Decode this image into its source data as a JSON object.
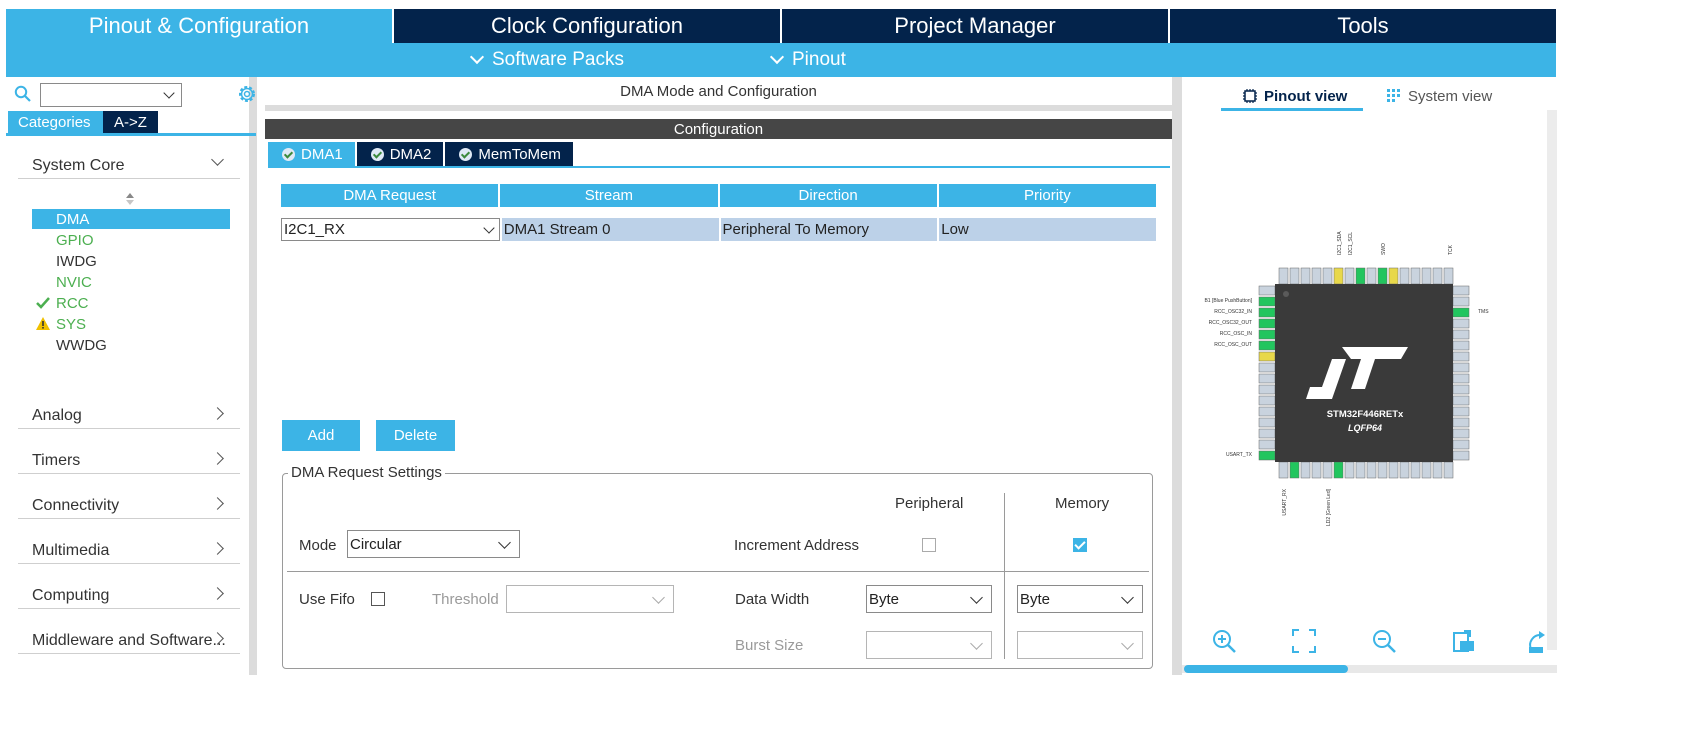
{
  "top_tabs": [
    {
      "label": "Pinout & Configuration"
    },
    {
      "label": "Clock Configuration"
    },
    {
      "label": "Project Manager"
    },
    {
      "label": "Tools"
    }
  ],
  "sub_tabs": [
    {
      "label": "Software Packs"
    },
    {
      "label": "Pinout"
    }
  ],
  "left": {
    "category_tabs": [
      "Categories",
      "A->Z"
    ],
    "system_core": {
      "label": "System Core",
      "items": [
        {
          "label": "DMA",
          "state": "selected"
        },
        {
          "label": "GPIO",
          "state": "configured"
        },
        {
          "label": "IWDG",
          "state": "none"
        },
        {
          "label": "NVIC",
          "state": "configured"
        },
        {
          "label": "RCC",
          "state": "ok"
        },
        {
          "label": "SYS",
          "state": "warning"
        },
        {
          "label": "WWDG",
          "state": "none"
        }
      ]
    },
    "sections": [
      "Analog",
      "Timers",
      "Connectivity",
      "Multimedia",
      "Computing",
      "Middleware and Software..."
    ]
  },
  "center": {
    "title": "DMA Mode and Configuration",
    "config_label": "Configuration",
    "dma_tabs": [
      "DMA1",
      "DMA2",
      "MemToMem"
    ],
    "table": {
      "headers": [
        "DMA Request",
        "Stream",
        "Direction",
        "Priority"
      ],
      "rows": [
        [
          "I2C1_RX",
          "DMA1 Stream 0",
          "Peripheral To Memory",
          "Low"
        ]
      ]
    },
    "buttons": {
      "add": "Add",
      "delete": "Delete"
    },
    "settings": {
      "legend": "DMA Request Settings",
      "peripheral_header": "Peripheral",
      "memory_header": "Memory",
      "mode_label": "Mode",
      "mode_value": "Circular",
      "increment_label": "Increment Address",
      "increment_peripheral": false,
      "increment_memory": true,
      "use_fifo_label": "Use Fifo",
      "use_fifo": false,
      "threshold_label": "Threshold",
      "threshold_value": "",
      "data_width_label": "Data Width",
      "data_width_peripheral": "Byte",
      "data_width_memory": "Byte",
      "burst_size_label": "Burst Size",
      "burst_peripheral": "",
      "burst_memory": ""
    }
  },
  "right": {
    "tabs": [
      "Pinout view",
      "System view"
    ],
    "chip": {
      "part": "STM32F446RETx",
      "package": "LQFP64",
      "left_labels": [
        "B1 [Blue PushButton]",
        "RCC_OSC32_IN",
        "RCC_OSC32_OUT",
        "RCC_OSC_IN",
        "RCC_OSC_OUT",
        "USART_TX"
      ],
      "top_labels": [
        "I2C1_SDA",
        "I2C1_SCL",
        "SWO",
        "TCK"
      ],
      "right_labels": [
        "TMS"
      ],
      "bottom_labels": [
        "USART_RX",
        "LD2 [Green Led]"
      ]
    },
    "tool_icons": [
      "zoom-in-icon",
      "fit-screen-icon",
      "zoom-out-icon",
      "export-icon",
      "rotate-icon"
    ]
  },
  "colors": {
    "accent": "#3cb4e6",
    "navy": "#03234b",
    "ok_green": "#4caf50",
    "warn_yellow": "#f0c000",
    "pin_green": "#22c55e",
    "pin_yellow": "#e8d84a"
  }
}
